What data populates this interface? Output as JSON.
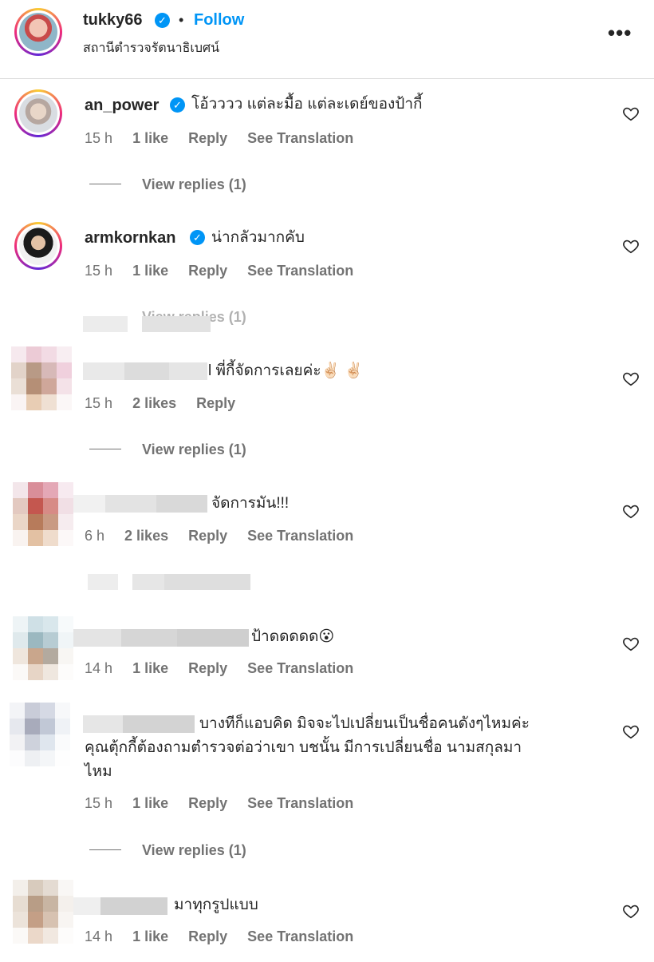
{
  "header": {
    "username": "tukky66",
    "separator": "•",
    "follow_label": "Follow",
    "location": "สถานีตำรวจรัตนาธิเบศน์",
    "more_icon": "more-horizontal-icon"
  },
  "comments": [
    {
      "username": "an_power",
      "verified": true,
      "text": "โอ้วววว แต่ละมื้อ แต่ละเดย์ของป้ากี้",
      "time": "15 h",
      "likes": "1 like",
      "reply_label": "Reply",
      "translate_label": "See Translation",
      "view_replies": "View replies (1)"
    },
    {
      "username": "armkornkan",
      "verified": true,
      "text": "น่ากลัวมากคับ",
      "time": "15 h",
      "likes": "1 like",
      "reply_label": "Reply",
      "translate_label": "See Translation",
      "view_replies": "View replies (1)"
    },
    {
      "username": "",
      "text": "l พี่กี้จัดการเลยค่ะ✌🏻 ✌🏻",
      "time": "15 h",
      "likes": "2 likes",
      "reply_label": "Reply",
      "view_replies": "View replies (1)"
    },
    {
      "username": "",
      "text": "จัดการมัน!!!",
      "time": "6 h",
      "likes": "2 likes",
      "reply_label": "Reply",
      "translate_label": "See Translation"
    },
    {
      "username": "",
      "text": "ป้าดดดดด😮",
      "time": "14 h",
      "likes": "1 like",
      "reply_label": "Reply",
      "translate_label": "See Translation"
    },
    {
      "username": "",
      "text_lines": [
        "บางทีก็แอบคิด มิจจะไปเปลี่ยนเป็นชื่อคนดังๆไหมค่ะ",
        "คุณตุ้กกี้ต้องถามตำรวจต่อว่าเขา บชนั้น มีการเปลี่ยนชื่อ นามสกุลมา",
        "ไหม"
      ],
      "time": "15 h",
      "likes": "1 like",
      "reply_label": "Reply",
      "translate_label": "See Translation",
      "view_replies": "View replies (1)"
    },
    {
      "username": "",
      "text": "มาทุกรูปแบบ",
      "time": "14 h",
      "likes": "1 like",
      "reply_label": "Reply",
      "translate_label": "See Translation"
    }
  ],
  "icons": {
    "like": "heart-outline-icon",
    "verified": "verified-badge-icon"
  },
  "colors": {
    "link_blue": "#0095f6",
    "meta_gray": "#737373",
    "text": "#262626"
  }
}
